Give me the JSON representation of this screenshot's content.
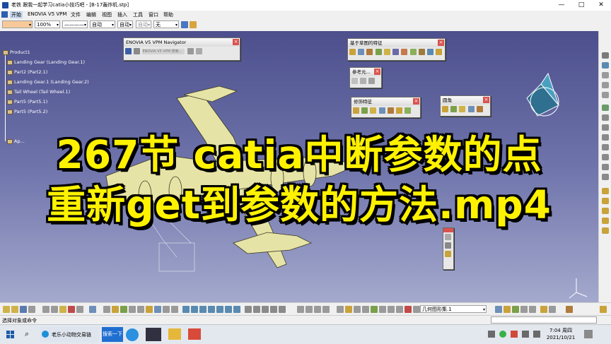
{
  "window": {
    "title": "老铁 跟我一起学习catia小技巧吧 - [B-17轰炸机.stp]",
    "min_label": "—",
    "max_label": "□",
    "close_label": "✕"
  },
  "menu": {
    "items": [
      {
        "label": "开始",
        "active": true
      },
      {
        "label": "ENOVIA V5 VPM"
      },
      {
        "label": "文件"
      },
      {
        "label": "编辑"
      },
      {
        "label": "视图"
      },
      {
        "label": "插入"
      },
      {
        "label": "工具"
      },
      {
        "label": "窗口"
      },
      {
        "label": "帮助"
      }
    ]
  },
  "properties_bar": {
    "zoom_value": "100%",
    "line_type": "————",
    "layer_value": "自动",
    "layer2_value": "自动",
    "layer3_value": "自动",
    "filter_value": "无"
  },
  "tree": {
    "items": [
      "Product1",
      "Landing Gear (Landing Gear.1)",
      "Part2 (Part2.1)",
      "Landing Gear.1 (Landing Gear.2)",
      "Tail Wheel (Tail Wheel.1)",
      "Part5 (Part5.1)",
      "Part5 (Part5.2)",
      "Ap..."
    ]
  },
  "panels": {
    "navigator": {
      "title": "ENOVIA V5 VPM Navigator",
      "caption": "ENOVIA V5 VPM 搜索..."
    },
    "sketch": {
      "title": "基于草图的特征"
    },
    "reference": {
      "title": "参考元..."
    },
    "dressup": {
      "title": "修饰特征"
    },
    "rounding": {
      "title": "圆角"
    }
  },
  "headline": {
    "line1": "267节 catia中断参数的点",
    "line2": "重新get到参数的方法.mp4"
  },
  "bottom_toolbar": {
    "geom_set_value": "几何图形集.1"
  },
  "status": {
    "prompt": "选择对象或命令"
  },
  "taskbar": {
    "app_label": "老乐小动物交易链",
    "search_label": "搜索一下",
    "time": "7:04 周四",
    "date": "2021/10/21"
  },
  "colors": {
    "headline_fill": "#fff200",
    "viewport_top": "#4c4f8c",
    "viewport_bottom": "#a4a9cd",
    "model_fill": "#e6e3a6"
  }
}
